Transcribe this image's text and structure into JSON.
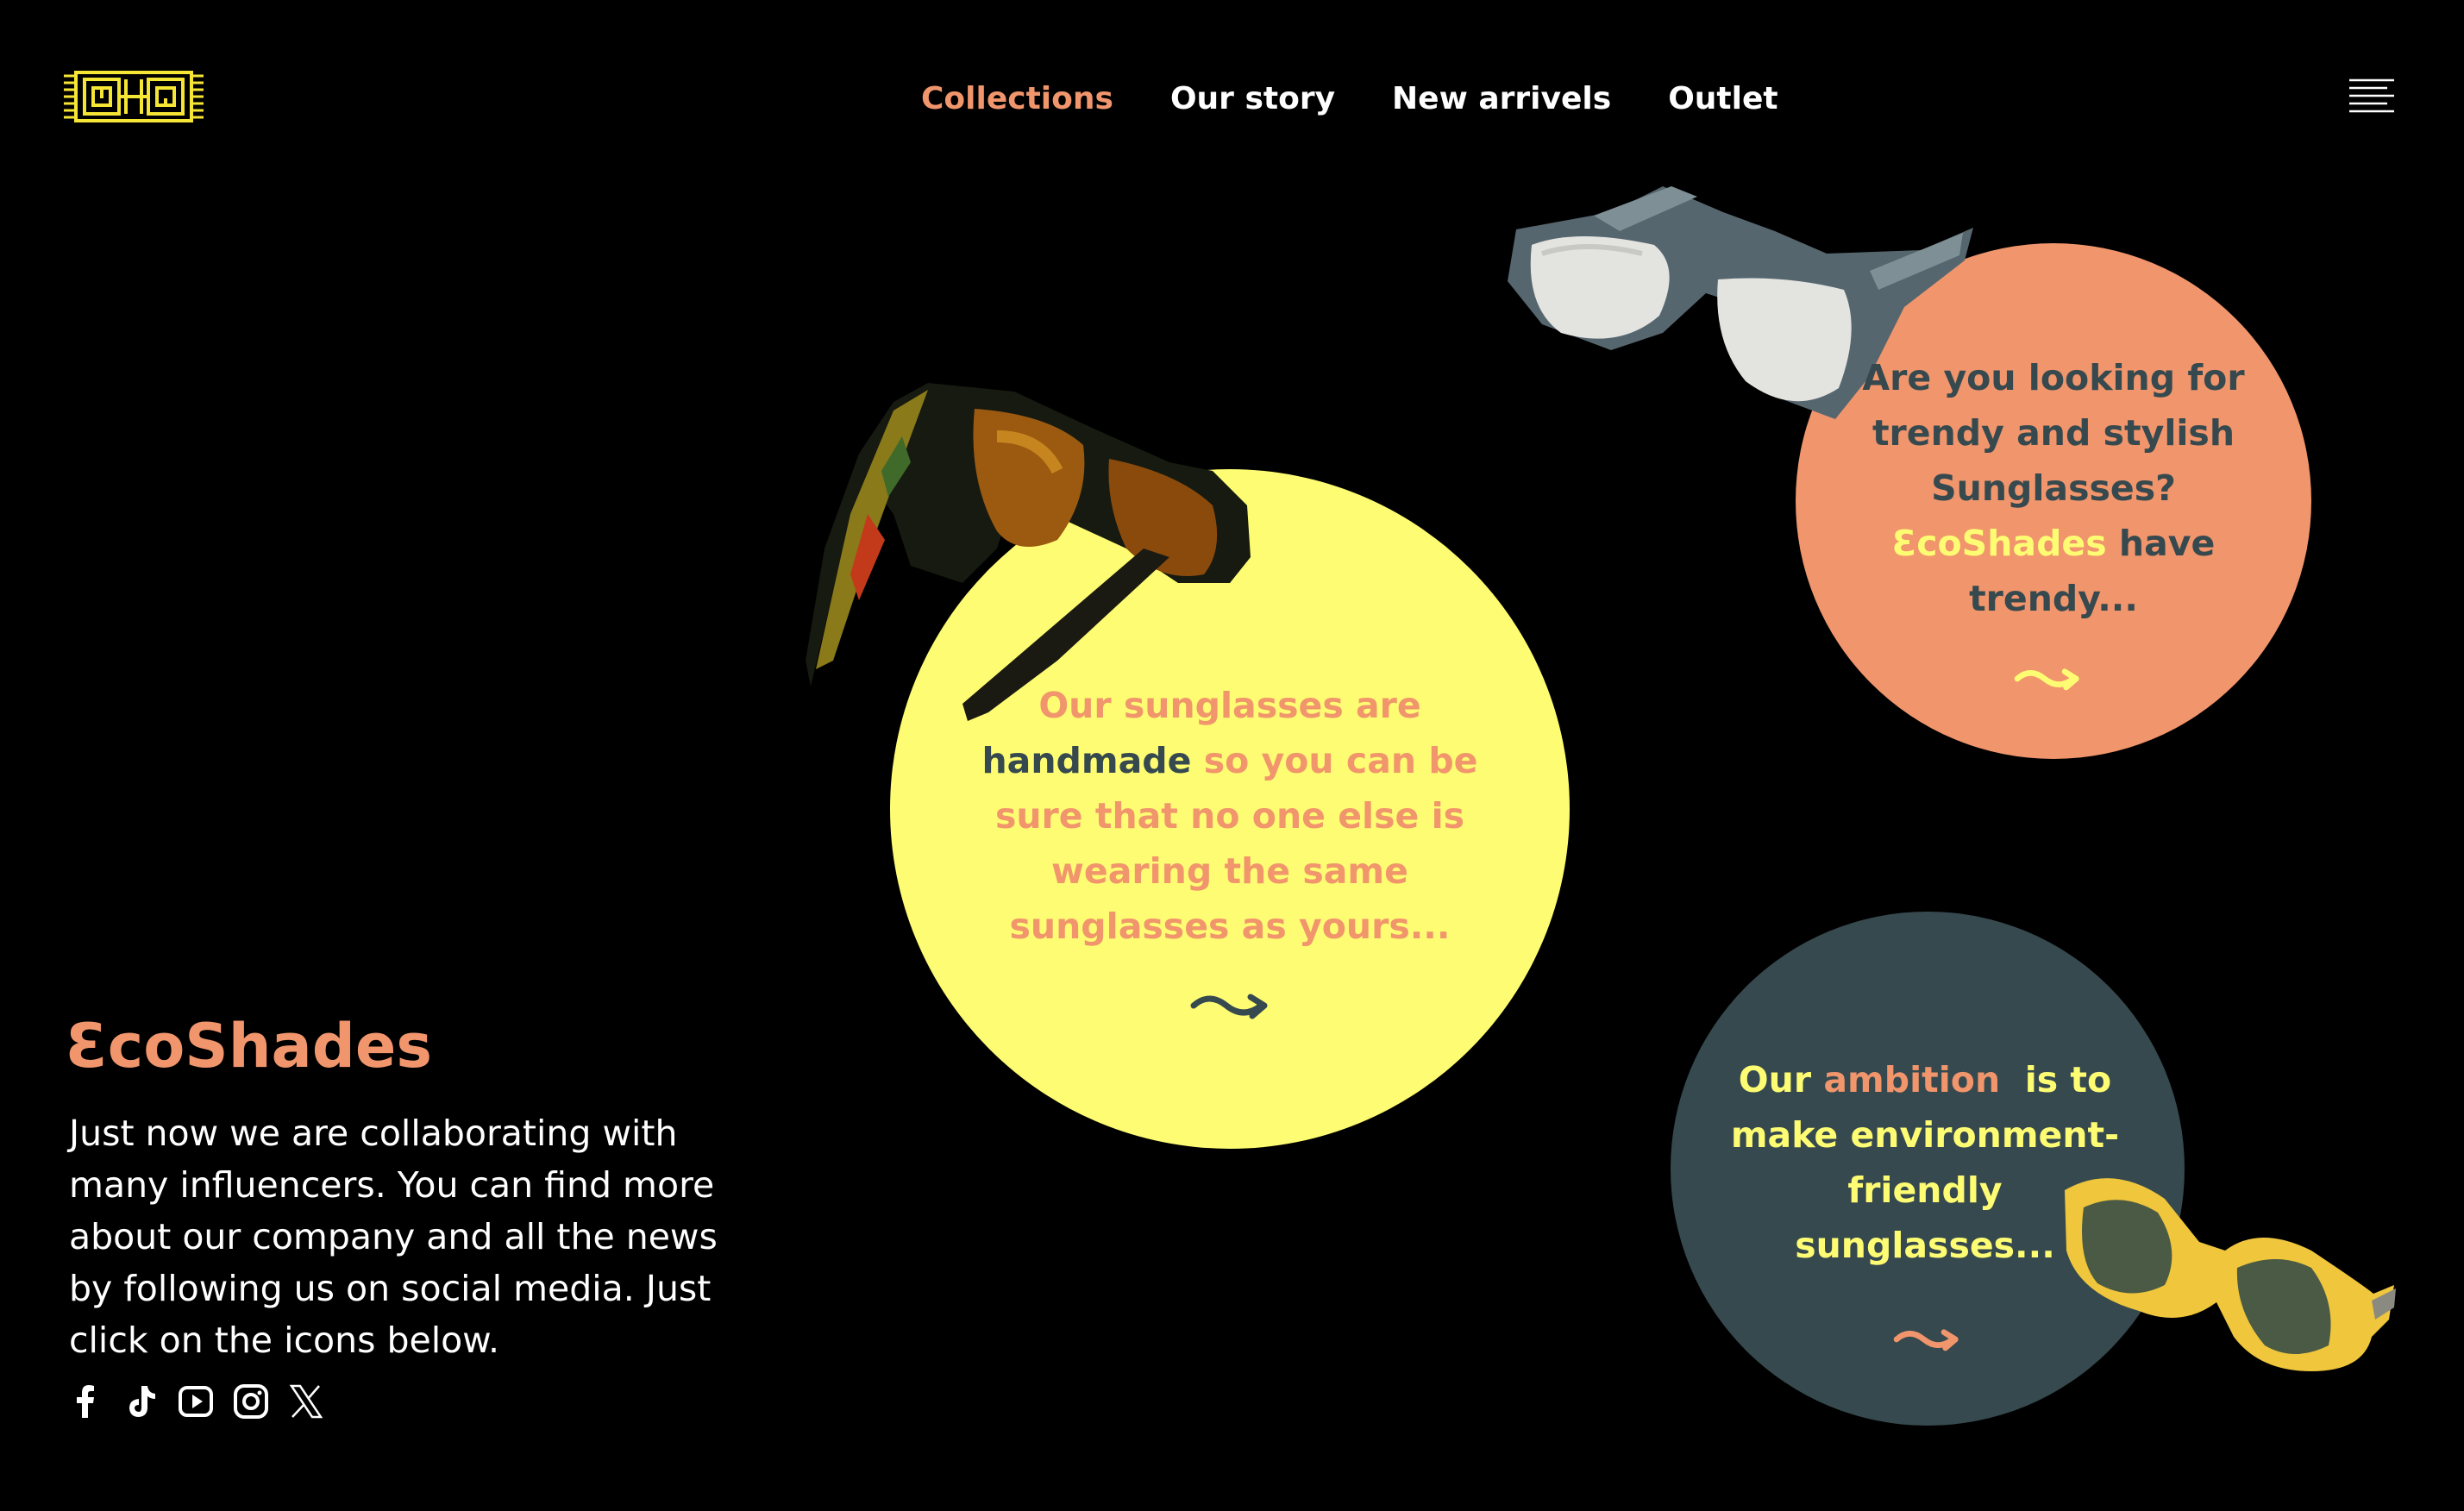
{
  "nav": {
    "items": [
      {
        "label": "Collections",
        "active": true
      },
      {
        "label": "Our story",
        "active": false
      },
      {
        "label": "New arrivels",
        "active": false
      },
      {
        "label": "Outlet",
        "active": false
      }
    ]
  },
  "icons": {
    "logo": "greek-key-logo",
    "menu": "hamburger-menu-icon",
    "social": [
      "facebook-icon",
      "tiktok-icon",
      "youtube-icon",
      "instagram-icon",
      "x-icon"
    ]
  },
  "colors": {
    "background": "#000000",
    "accent_orange": "#f0956c",
    "accent_yellow": "#fefc73",
    "accent_teal": "#36494e",
    "logo_yellow": "#f5e535"
  },
  "cards": {
    "handmade": {
      "line1": "Our sunglasses are",
      "highlight": "handmade",
      "rest1": " so you can be",
      "line3": "sure that no one else is",
      "line4": "wearing the same",
      "line5": "sunglasses as yours..."
    },
    "trendy": {
      "line1": "Are you looking for",
      "line2": "trendy and stylish",
      "line3": "Sunglasses?",
      "highlight": "ƐcoShades",
      "rest4": " have",
      "line5": "trendy..."
    },
    "ambition": {
      "pre": "Our ",
      "highlight": "ambition",
      "post": "  is to",
      "line2": "make environment-",
      "line3": "friendly",
      "line4": "sunglasses..."
    }
  },
  "brand": {
    "name": "ƐcoShades",
    "description": "Just now we are collaborating with many influencers. You can find more about our company and all the news by following us on social media. Just click on the icons below."
  }
}
